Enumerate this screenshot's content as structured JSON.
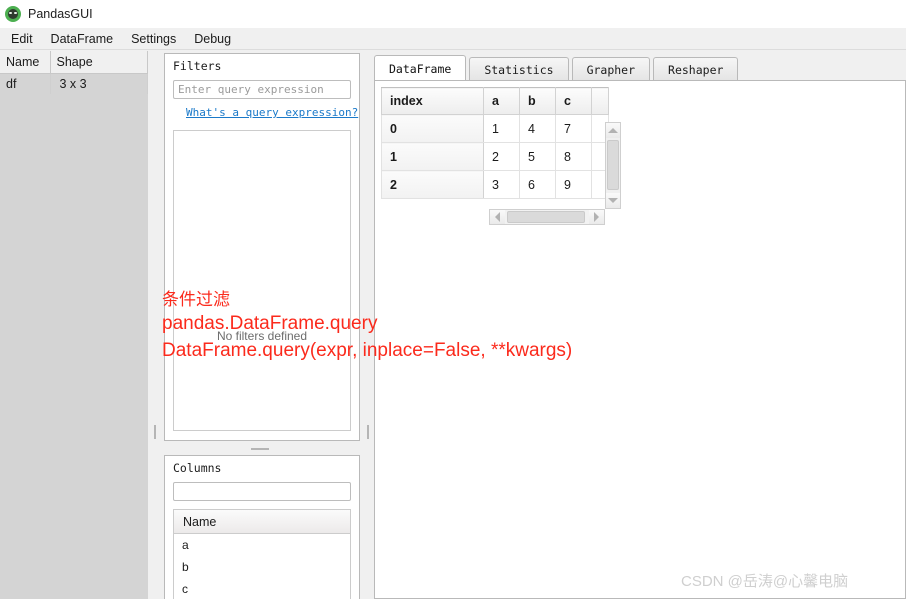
{
  "window": {
    "title": "PandasGUI",
    "icon": "panda-app-icon"
  },
  "menubar": {
    "items": [
      {
        "label": "Edit"
      },
      {
        "label": "DataFrame"
      },
      {
        "label": "Settings"
      },
      {
        "label": "Debug"
      }
    ]
  },
  "sidebar": {
    "headers": {
      "name": "Name",
      "shape": "Shape"
    },
    "rows": [
      {
        "name": "df",
        "shape": "3 x 3"
      }
    ]
  },
  "filters_panel": {
    "title": "Filters",
    "query_input": {
      "value": "",
      "placeholder": "Enter query expression"
    },
    "help_link": "What's a query expression?",
    "empty_text": "No filters defined"
  },
  "columns_panel": {
    "title": "Columns",
    "search_input": {
      "value": "",
      "placeholder": ""
    },
    "header": "Name",
    "items": [
      {
        "label": "a"
      },
      {
        "label": "b"
      },
      {
        "label": "c"
      }
    ]
  },
  "tabs": [
    {
      "label": "DataFrame",
      "active": true
    },
    {
      "label": "Statistics",
      "active": false
    },
    {
      "label": "Grapher",
      "active": false
    },
    {
      "label": "Reshaper",
      "active": false
    }
  ],
  "dataframe": {
    "columns": [
      "index",
      "a",
      "b",
      "c"
    ],
    "rows": [
      {
        "index": "0",
        "a": "1",
        "b": "4",
        "c": "7"
      },
      {
        "index": "1",
        "a": "2",
        "b": "5",
        "c": "8"
      },
      {
        "index": "2",
        "a": "3",
        "b": "6",
        "c": "9"
      }
    ]
  },
  "annotation": {
    "line1": "条件过滤",
    "line2": "pandas.DataFrame.query",
    "line3": "DataFrame.query(expr, inplace=False, **kwargs)",
    "color": "#fb2a1c"
  },
  "watermark": {
    "text": "CSDN @岳涛@心馨电脑"
  },
  "colors": {
    "accent_link": "#1a79c9",
    "titlebar_bg": "#ffffff",
    "chrome_bg": "#f0f0f0",
    "sidebar_row_bg": "#d4d4d4"
  }
}
